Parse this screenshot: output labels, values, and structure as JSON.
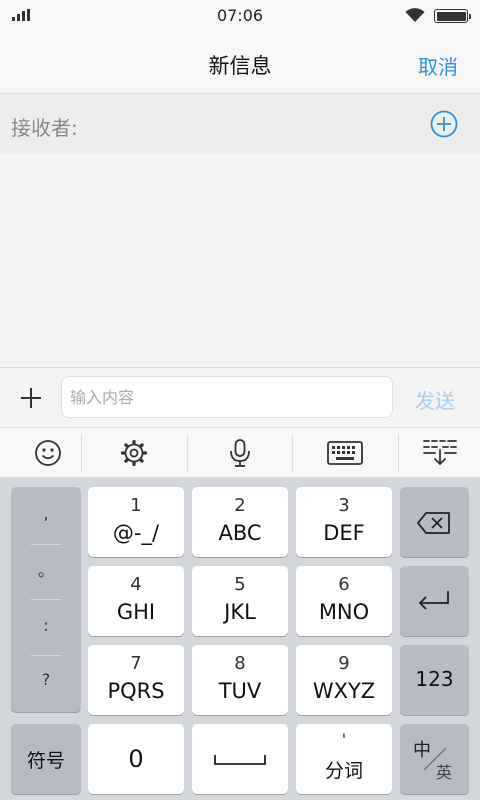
{
  "status_bar": {
    "time": "07:06"
  },
  "header": {
    "title": "新信息",
    "cancel_label": "取消"
  },
  "recipient": {
    "label": "接收者:"
  },
  "compose": {
    "placeholder": "输入内容",
    "send_label": "发送"
  },
  "toolbar": {
    "icons": [
      "emoji-icon",
      "settings-icon",
      "microphone-icon",
      "keyboard-icon",
      "collapse-keyboard-icon"
    ]
  },
  "keyboard": {
    "punctuation": [
      ",",
      "。",
      ":",
      "?"
    ],
    "keys": [
      {
        "num": "1",
        "letters": "@-_/"
      },
      {
        "num": "2",
        "letters": "ABC"
      },
      {
        "num": "3",
        "letters": "DEF"
      },
      {
        "num": "4",
        "letters": "GHI"
      },
      {
        "num": "5",
        "letters": "JKL"
      },
      {
        "num": "6",
        "letters": "MNO"
      },
      {
        "num": "7",
        "letters": "PQRS"
      },
      {
        "num": "8",
        "letters": "TUV"
      },
      {
        "num": "9",
        "letters": "WXYZ"
      }
    ],
    "symbols_label": "符号",
    "zero_label": "0",
    "split_label": "分词",
    "split_mark": "'",
    "numbers_label": "123",
    "lang_primary": "中",
    "lang_secondary": "英"
  },
  "colors": {
    "accent": "#2f8fe0",
    "send_disabled": "#a9cdef",
    "keyboard_bg": "#d3d6db",
    "function_key": "#b7bcc4"
  }
}
